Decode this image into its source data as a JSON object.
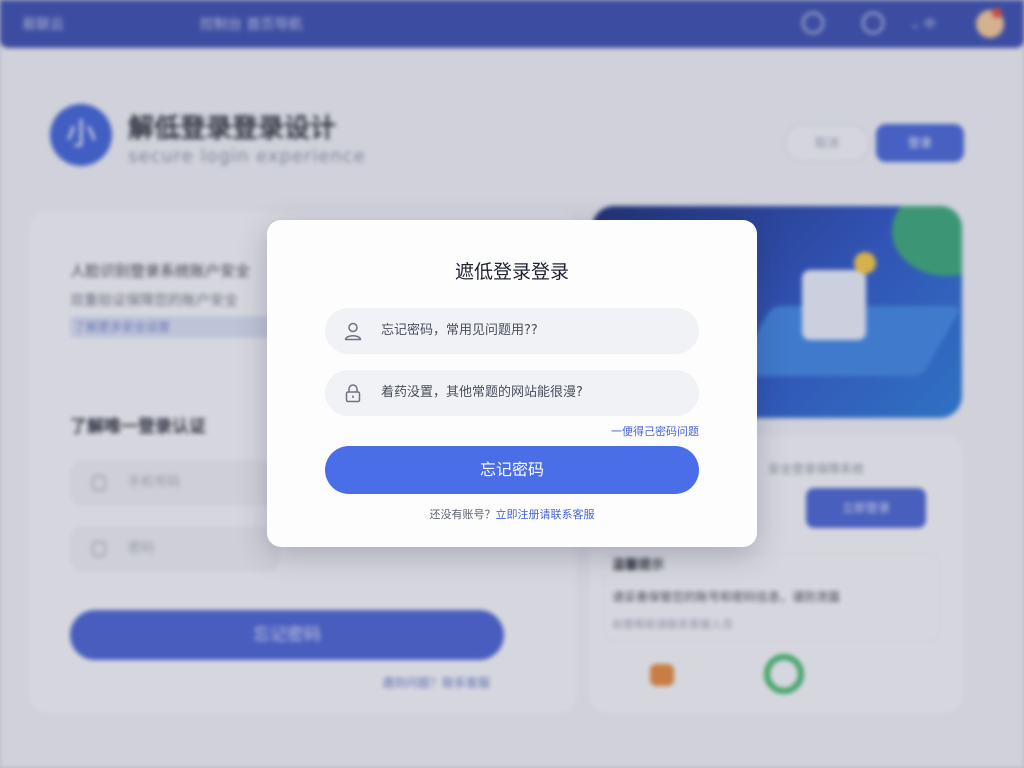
{
  "topbar": {
    "brand": "易联云",
    "menu": "控制台 首页导航"
  },
  "header": {
    "logo_char": "小",
    "title": "解低登录登录设计",
    "subtitle": "secure login experience",
    "ghost_button": "取消",
    "primary_button": "登录"
  },
  "left_panel": {
    "line1": "人脸识别登录系统账户安全",
    "line2": "双重验证保障您的账户安全",
    "link": "了解更多安全设置",
    "heading": "了解唯一登录认证",
    "input1_placeholder": "手机号码",
    "input2_placeholder": "密码",
    "submit": "忘记密码",
    "footer_link": "遇到问题？联系客服"
  },
  "right_panel": {
    "text": "安全登录保障系统",
    "button": "立即登录",
    "heading": "温馨提示",
    "line1": "请妥善保管您的账号和密码信息，谨防泄露",
    "line2": "如需帮助请联系客服人员"
  },
  "modal": {
    "title": "遮低登录登录",
    "username_placeholder": "忘记密码，常用见问题用??",
    "password_placeholder": "着药没置，其他常题的网站能很漫?",
    "forgot_link": "一便得己密码问题",
    "submit_label": "忘记密码",
    "footer_text": "还没有账号？",
    "footer_link": "立即注册请联系客服"
  },
  "colors": {
    "primary": "#4a6de8",
    "topbar": "#3a4fb0",
    "link": "#4564d6"
  }
}
